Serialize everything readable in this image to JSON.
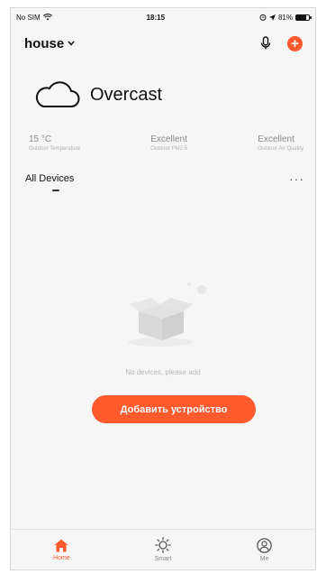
{
  "status_bar": {
    "carrier": "No SIM",
    "time": "18:15",
    "battery": "81%",
    "battery_level": 0.81
  },
  "header": {
    "home_name": "house"
  },
  "weather": {
    "condition": "Overcast"
  },
  "environment": [
    {
      "value": "15 °C",
      "label": "Outdoor Temperature"
    },
    {
      "value": "Excellent",
      "label": "Outdoor PM2.5"
    },
    {
      "value": "Excellent",
      "label": "Outdoor Air Quality"
    }
  ],
  "devices": {
    "title": "All Devices",
    "empty_text": "No devices, please add",
    "add_button": "Добавить устройство"
  },
  "tabs": [
    {
      "label": "Home",
      "icon": "home-icon",
      "active": true
    },
    {
      "label": "Smart",
      "icon": "sun-icon",
      "active": false
    },
    {
      "label": "Me",
      "icon": "user-icon",
      "active": false
    }
  ],
  "colors": {
    "accent": "#ff5a2e",
    "background": "#f6f6f6"
  }
}
